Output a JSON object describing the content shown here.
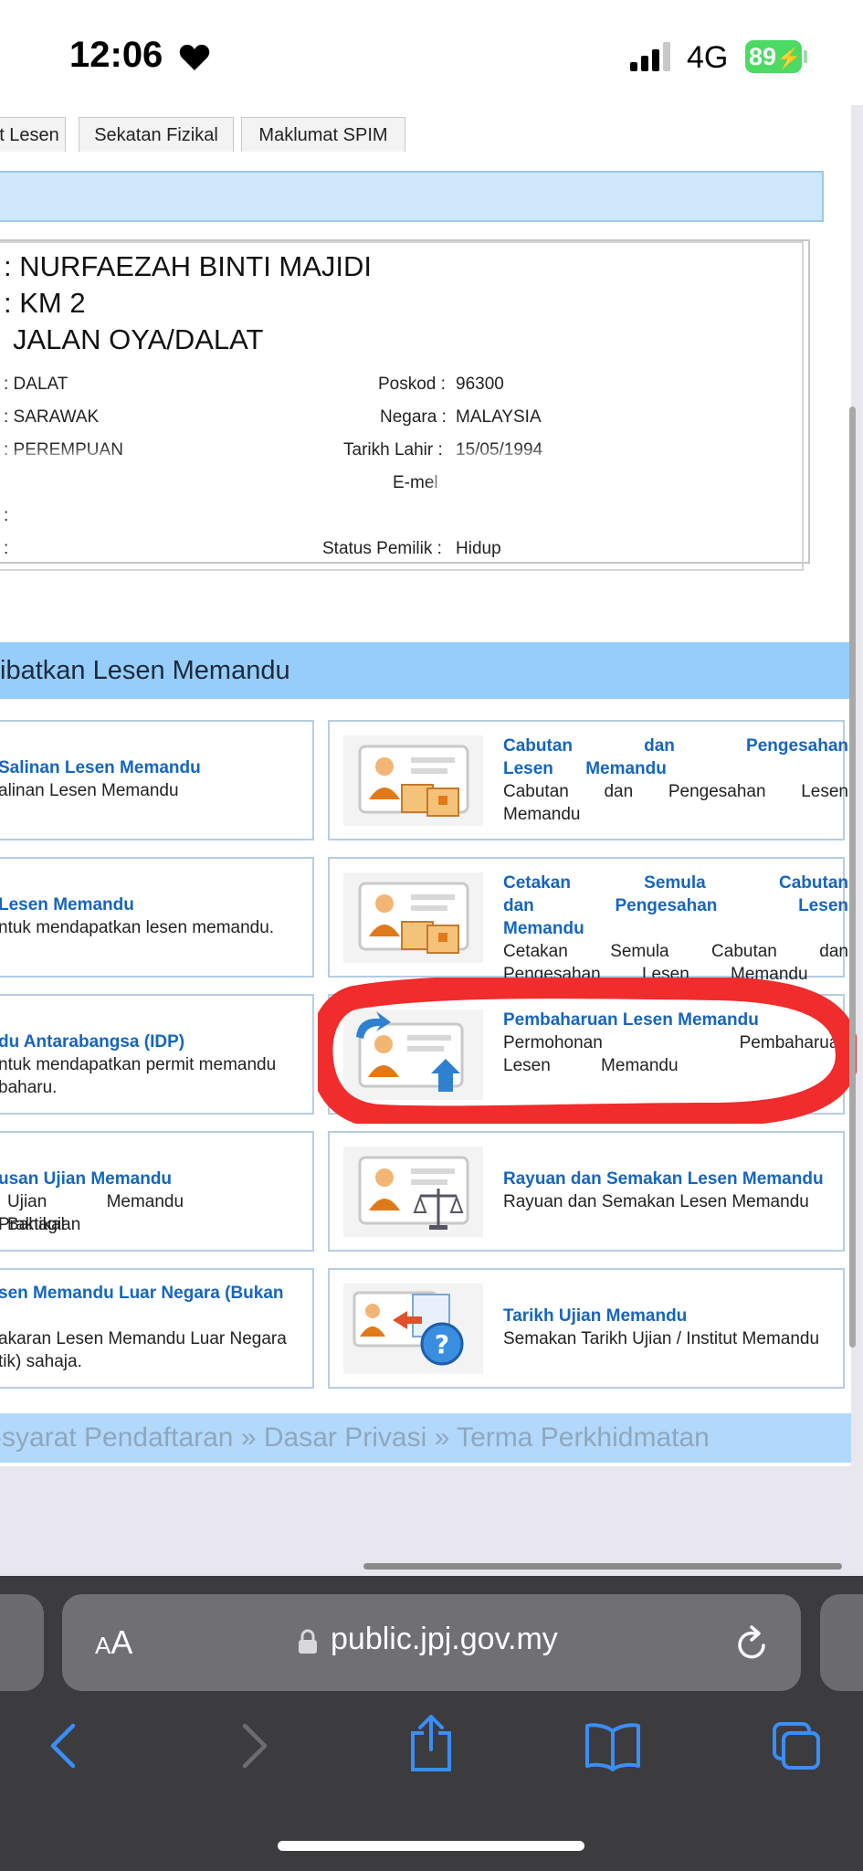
{
  "status_bar": {
    "time": "12:06",
    "network": "4G",
    "battery": "89"
  },
  "tabs": [
    "t Lesen",
    "Sekatan Fizikal",
    "Maklumat SPIM"
  ],
  "owner": {
    "name": ": NURFAEZAH BINTI MAJIDI",
    "address1": ": KM 2",
    "address2": "JALAN OYA/DALAT",
    "city": ": DALAT",
    "state": ": SARAWAK",
    "gender": ": PEREMPUAN",
    "blank1": ":",
    "blank2": ":",
    "postcode_label": "Poskod :",
    "postcode": "96300",
    "country_label": "Negara :",
    "country": "MALAYSIA",
    "dob_label": "Tarikh Lahir :",
    "dob": "15/05/1994",
    "email_label": "E-mel",
    "status_label": "Status Pemilik :",
    "status": "Hidup"
  },
  "section_title": "ibatkan Lesen Memandu",
  "left_cards": [
    {
      "title": "Salinan Lesen Memandu",
      "desc": "alinan Lesen Memandu"
    },
    {
      "title": "Lesen Memandu",
      "desc": "ntuk mendapatkan lesen memandu."
    },
    {
      "title": "du Antarabangsa (IDP)",
      "desc": "ntuk mendapatkan permit memandu",
      "desc2": "baharu."
    },
    {
      "title": "usan Ujian Memandu",
      "desc": "Ujian Memandu Bahagian",
      "desc2": "Praktikal"
    },
    {
      "title": "sen Memandu Luar Negara (Bukan",
      "desc": "akaran Lesen Memandu Luar Negara",
      "desc2": "tik) sahaja."
    }
  ],
  "right_cards": [
    {
      "title": "Cabutan dan Pengesahan Lesen Memandu",
      "desc": "Cabutan dan Pengesahan Lesen Memandu",
      "icon": "id-card-documents-icon"
    },
    {
      "title": "Cetakan Semula Cabutan dan Pengesahan Lesen Memandu",
      "desc": "Cetakan Semula Cabutan dan Pengesahan Lesen Memandu",
      "icon": "id-card-documents-icon"
    },
    {
      "title": "Pembaharuan Lesen Memandu",
      "desc": "Permohonan Pembaharuan Lesen Memandu",
      "icon": "id-card-renew-icon"
    },
    {
      "title": "Rayuan dan Semakan Lesen Memandu",
      "desc": "Rayuan dan Semakan Lesen Memandu",
      "icon": "id-card-scale-icon"
    },
    {
      "title": "Tarikh Ujian Memandu",
      "desc": "Semakan Tarikh Ujian / Institut Memandu",
      "icon": "id-card-question-icon"
    }
  ],
  "footer": {
    "link1": "-syarat Pendaftaran",
    "sep": "»",
    "link2": "Dasar Privasi",
    "link3": "Terma Perkhidmatan"
  },
  "browser": {
    "aa_small": "A",
    "aa_big": "A",
    "url": "public.jpj.gov.my"
  },
  "colors": {
    "accent_blue": "#1565c0",
    "header_blue": "#97cdfb",
    "annotation_red": "#f02c2c",
    "battery_green": "#4cd964"
  }
}
